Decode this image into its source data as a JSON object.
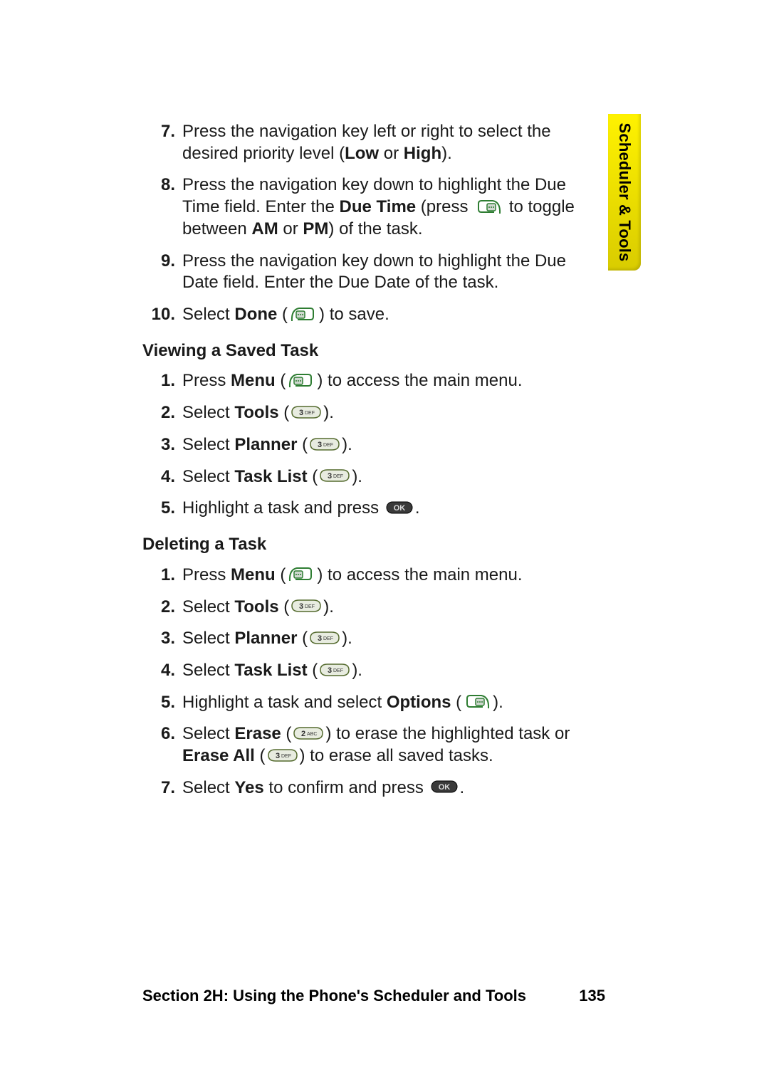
{
  "sidebar": {
    "tab": "Scheduler & Tools"
  },
  "section_a": {
    "items": [
      {
        "num": "7.",
        "html": "Press the navigation key left or right to select the desired priority level (<b>Low</b> or <b>High</b>)."
      },
      {
        "num": "8.",
        "html": "Press the navigation key down to highlight the Due Time field. Enter the <b>Due Time</b> (press {ICON_SOFTR} to toggle between <b>AM</b> or <b>PM</b>) of the task."
      },
      {
        "num": "9.",
        "html": "Press the navigation key down to highlight the Due Date field. Enter the Due Date of the task."
      },
      {
        "num": "10.",
        "html": "Select <b>Done</b> ({ICON_SOFTL}) to save."
      }
    ]
  },
  "heading_b": "Viewing a Saved Task",
  "section_b": {
    "items": [
      {
        "num": "1.",
        "html": "Press <b>Menu</b> ({ICON_SOFTL}) to access the main menu."
      },
      {
        "num": "2.",
        "html": "Select <b>Tools</b> ({ICON_KEY3})."
      },
      {
        "num": "3.",
        "html": "Select <b>Planner</b> ({ICON_KEY3})."
      },
      {
        "num": "4.",
        "html": "Select <b>Task List</b> ({ICON_KEY3})."
      },
      {
        "num": "5.",
        "html": "Highlight a task and press {ICON_OK}."
      }
    ]
  },
  "heading_c": "Deleting a Task",
  "section_c": {
    "items": [
      {
        "num": "1.",
        "html": "Press <b>Menu</b> ({ICON_SOFTL}) to access the main menu."
      },
      {
        "num": "2.",
        "html": "Select <b>Tools</b> ({ICON_KEY3})."
      },
      {
        "num": "3.",
        "html": "Select <b>Planner</b> ({ICON_KEY3})."
      },
      {
        "num": "4.",
        "html": "Select <b>Task List</b> ({ICON_KEY3})."
      },
      {
        "num": "5.",
        "html": "Highlight a task and select <b>Options</b> ({ICON_SOFTR})."
      },
      {
        "num": "6.",
        "html": "Select <b>Erase</b> ({ICON_KEY2}) to erase the highlighted task or <b>Erase All</b> ({ICON_KEY3}) to erase all saved tasks."
      },
      {
        "num": "7.",
        "html": "Select <b>Yes</b> to confirm and press {ICON_OK}."
      }
    ]
  },
  "footer": {
    "section": "Section 2H: Using the Phone's Scheduler and Tools",
    "page": "135"
  }
}
